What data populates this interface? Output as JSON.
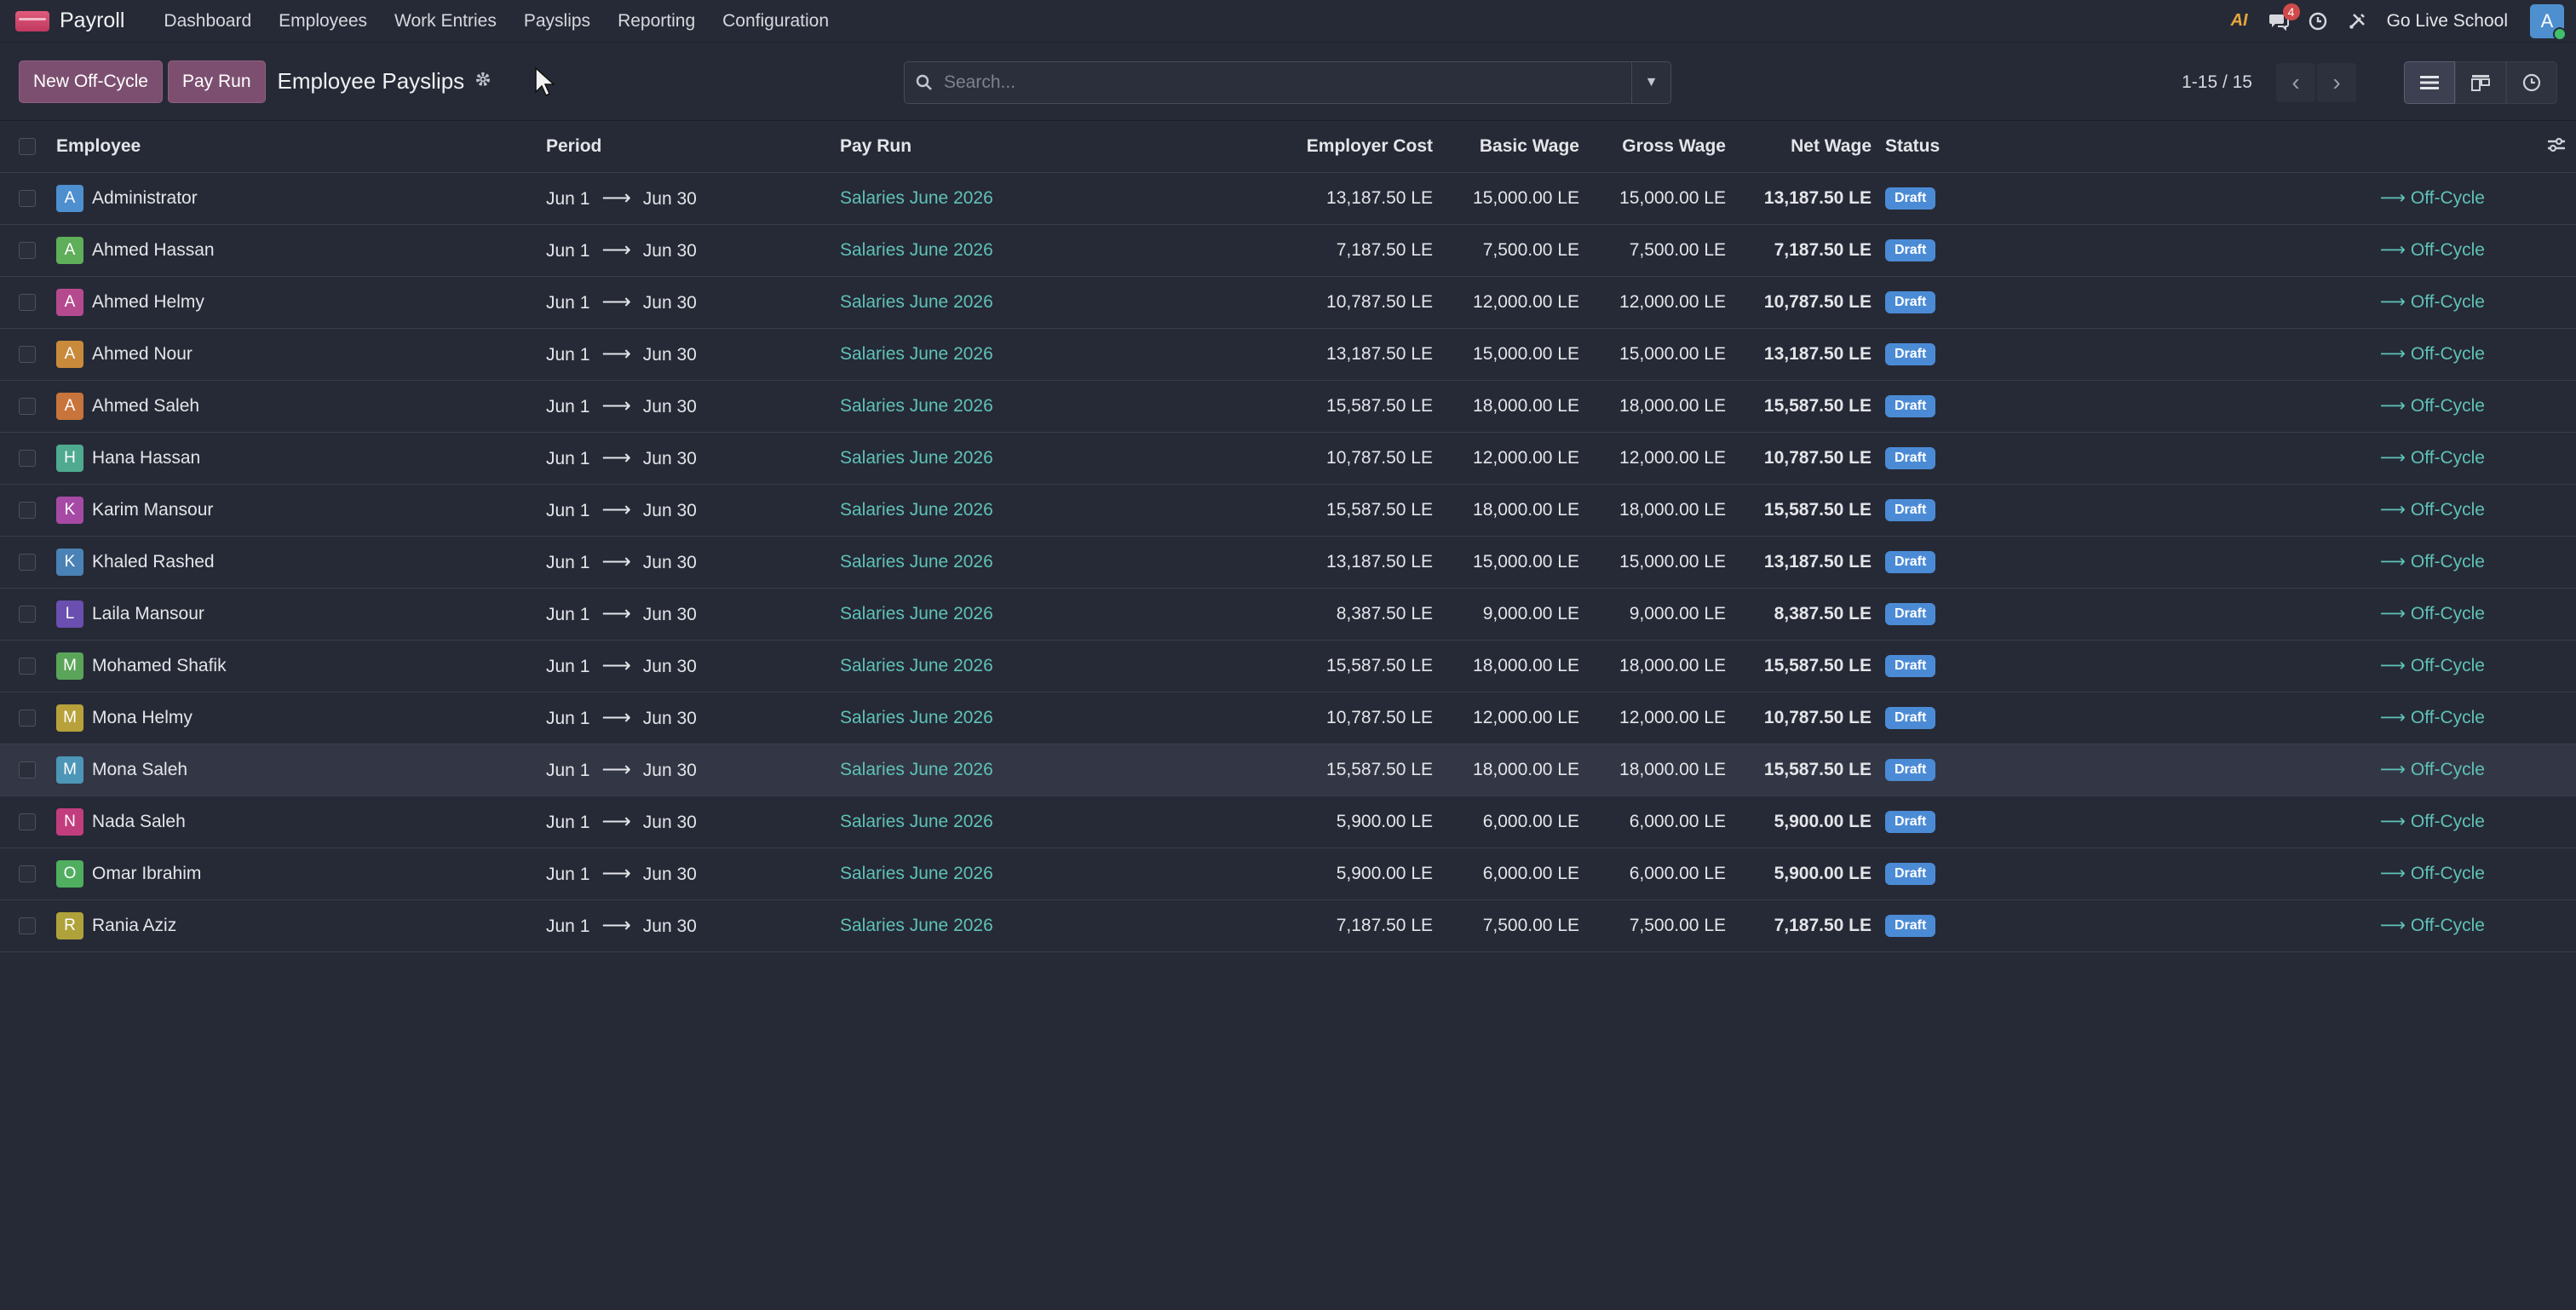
{
  "navbar": {
    "app_name": "Payroll",
    "menu": [
      "Dashboard",
      "Employees",
      "Work Entries",
      "Payslips",
      "Reporting",
      "Configuration"
    ],
    "ai_label": "AI",
    "messages_count": "4",
    "company": "Go Live School",
    "user_initial": "A"
  },
  "control_panel": {
    "new_offcycle_label": "New Off-Cycle",
    "pay_run_label": "Pay Run",
    "title": "Employee Payslips",
    "search_placeholder": "Search...",
    "pager_value": "1-15 / 15"
  },
  "table": {
    "headers": {
      "employee": "Employee",
      "period": "Period",
      "pay_run": "Pay Run",
      "employer_cost": "Employer Cost",
      "basic_wage": "Basic Wage",
      "gross_wage": "Gross Wage",
      "net_wage": "Net Wage",
      "status": "Status"
    },
    "rows": [
      {
        "initial": "A",
        "color": "#4e8fcf",
        "name": "Administrator",
        "from": "Jun 1",
        "to": "Jun 30",
        "pay_run": "Salaries June 2026",
        "employer_cost": "13,187.50 LE",
        "basic": "15,000.00 LE",
        "gross": "15,000.00 LE",
        "net": "13,187.50 LE",
        "status": "Draft",
        "type": "Off-Cycle"
      },
      {
        "initial": "A",
        "color": "#5fae5a",
        "name": "Ahmed Hassan",
        "from": "Jun 1",
        "to": "Jun 30",
        "pay_run": "Salaries June 2026",
        "employer_cost": "7,187.50 LE",
        "basic": "7,500.00 LE",
        "gross": "7,500.00 LE",
        "net": "7,187.50 LE",
        "status": "Draft",
        "type": "Off-Cycle"
      },
      {
        "initial": "A",
        "color": "#b64a8f",
        "name": "Ahmed Helmy",
        "from": "Jun 1",
        "to": "Jun 30",
        "pay_run": "Salaries June 2026",
        "employer_cost": "10,787.50 LE",
        "basic": "12,000.00 LE",
        "gross": "12,000.00 LE",
        "net": "10,787.50 LE",
        "status": "Draft",
        "type": "Off-Cycle"
      },
      {
        "initial": "A",
        "color": "#c98a3b",
        "name": "Ahmed Nour",
        "from": "Jun 1",
        "to": "Jun 30",
        "pay_run": "Salaries June 2026",
        "employer_cost": "13,187.50 LE",
        "basic": "15,000.00 LE",
        "gross": "15,000.00 LE",
        "net": "13,187.50 LE",
        "status": "Draft",
        "type": "Off-Cycle"
      },
      {
        "initial": "A",
        "color": "#c9743b",
        "name": "Ahmed Saleh",
        "from": "Jun 1",
        "to": "Jun 30",
        "pay_run": "Salaries June 2026",
        "employer_cost": "15,587.50 LE",
        "basic": "18,000.00 LE",
        "gross": "18,000.00 LE",
        "net": "15,587.50 LE",
        "status": "Draft",
        "type": "Off-Cycle"
      },
      {
        "initial": "H",
        "color": "#4faa8f",
        "name": "Hana Hassan",
        "from": "Jun 1",
        "to": "Jun 30",
        "pay_run": "Salaries June 2026",
        "employer_cost": "10,787.50 LE",
        "basic": "12,000.00 LE",
        "gross": "12,000.00 LE",
        "net": "10,787.50 LE",
        "status": "Draft",
        "type": "Off-Cycle"
      },
      {
        "initial": "K",
        "color": "#a64aa6",
        "name": "Karim Mansour",
        "from": "Jun 1",
        "to": "Jun 30",
        "pay_run": "Salaries June 2026",
        "employer_cost": "15,587.50 LE",
        "basic": "18,000.00 LE",
        "gross": "18,000.00 LE",
        "net": "15,587.50 LE",
        "status": "Draft",
        "type": "Off-Cycle"
      },
      {
        "initial": "K",
        "color": "#4a82b6",
        "name": "Khaled Rashed",
        "from": "Jun 1",
        "to": "Jun 30",
        "pay_run": "Salaries June 2026",
        "employer_cost": "13,187.50 LE",
        "basic": "15,000.00 LE",
        "gross": "15,000.00 LE",
        "net": "13,187.50 LE",
        "status": "Draft",
        "type": "Off-Cycle"
      },
      {
        "initial": "L",
        "color": "#6a4fb0",
        "name": "Laila Mansour",
        "from": "Jun 1",
        "to": "Jun 30",
        "pay_run": "Salaries June 2026",
        "employer_cost": "8,387.50 LE",
        "basic": "9,000.00 LE",
        "gross": "9,000.00 LE",
        "net": "8,387.50 LE",
        "status": "Draft",
        "type": "Off-Cycle"
      },
      {
        "initial": "M",
        "color": "#5aa55a",
        "name": "Mohamed Shafik",
        "from": "Jun 1",
        "to": "Jun 30",
        "pay_run": "Salaries June 2026",
        "employer_cost": "15,587.50 LE",
        "basic": "18,000.00 LE",
        "gross": "18,000.00 LE",
        "net": "15,587.50 LE",
        "status": "Draft",
        "type": "Off-Cycle"
      },
      {
        "initial": "M",
        "color": "#b8a13b",
        "name": "Mona Helmy",
        "from": "Jun 1",
        "to": "Jun 30",
        "pay_run": "Salaries June 2026",
        "employer_cost": "10,787.50 LE",
        "basic": "12,000.00 LE",
        "gross": "12,000.00 LE",
        "net": "10,787.50 LE",
        "status": "Draft",
        "type": "Off-Cycle"
      },
      {
        "initial": "M",
        "color": "#4d96b8",
        "name": "Mona Saleh",
        "from": "Jun 1",
        "to": "Jun 30",
        "pay_run": "Salaries June 2026",
        "employer_cost": "15,587.50 LE",
        "basic": "18,000.00 LE",
        "gross": "18,000.00 LE",
        "net": "15,587.50 LE",
        "status": "Draft",
        "type": "Off-Cycle",
        "hover": true
      },
      {
        "initial": "N",
        "color": "#c23d7e",
        "name": "Nada Saleh",
        "from": "Jun 1",
        "to": "Jun 30",
        "pay_run": "Salaries June 2026",
        "employer_cost": "5,900.00 LE",
        "basic": "6,000.00 LE",
        "gross": "6,000.00 LE",
        "net": "5,900.00 LE",
        "status": "Draft",
        "type": "Off-Cycle"
      },
      {
        "initial": "O",
        "color": "#4fae5f",
        "name": "Omar Ibrahim",
        "from": "Jun 1",
        "to": "Jun 30",
        "pay_run": "Salaries June 2026",
        "employer_cost": "5,900.00 LE",
        "basic": "6,000.00 LE",
        "gross": "6,000.00 LE",
        "net": "5,900.00 LE",
        "status": "Draft",
        "type": "Off-Cycle"
      },
      {
        "initial": "R",
        "color": "#b0a23b",
        "name": "Rania Aziz",
        "from": "Jun 1",
        "to": "Jun 30",
        "pay_run": "Salaries June 2026",
        "employer_cost": "7,187.50 LE",
        "basic": "7,500.00 LE",
        "gross": "7,500.00 LE",
        "net": "7,187.50 LE",
        "status": "Draft",
        "type": "Off-Cycle"
      }
    ]
  }
}
